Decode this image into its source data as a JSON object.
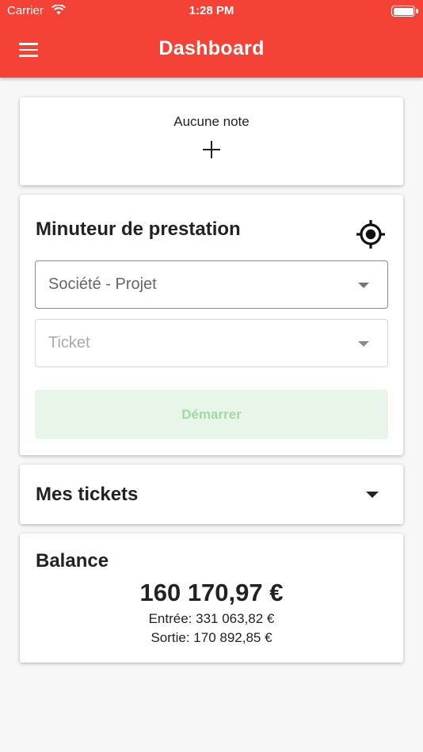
{
  "status_bar": {
    "carrier": "Carrier",
    "time": "1:28 PM"
  },
  "app_bar": {
    "title": "Dashboard",
    "background_color": "#f44336",
    "menu_icon": "hamburger-menu-icon"
  },
  "notes_card": {
    "label": "Aucune note",
    "add_icon": "plus-icon"
  },
  "timer_card": {
    "title": "Minuteur de prestation",
    "location_icon": "gps-target-icon",
    "project_select": {
      "placeholder": "Société - Projet"
    },
    "ticket_select": {
      "placeholder": "Ticket"
    },
    "start_button": {
      "label": "Démarrer",
      "background_color": "#e8f5e9",
      "text_color": "#a5d6a7"
    }
  },
  "tickets_card": {
    "title": "Mes tickets",
    "expand_icon": "caret-down-icon"
  },
  "balance_card": {
    "title": "Balance",
    "total": "160 170,97 €",
    "income": "Entrée: 331 063,82 €",
    "expense": "Sortie: 170 892,85 €"
  }
}
